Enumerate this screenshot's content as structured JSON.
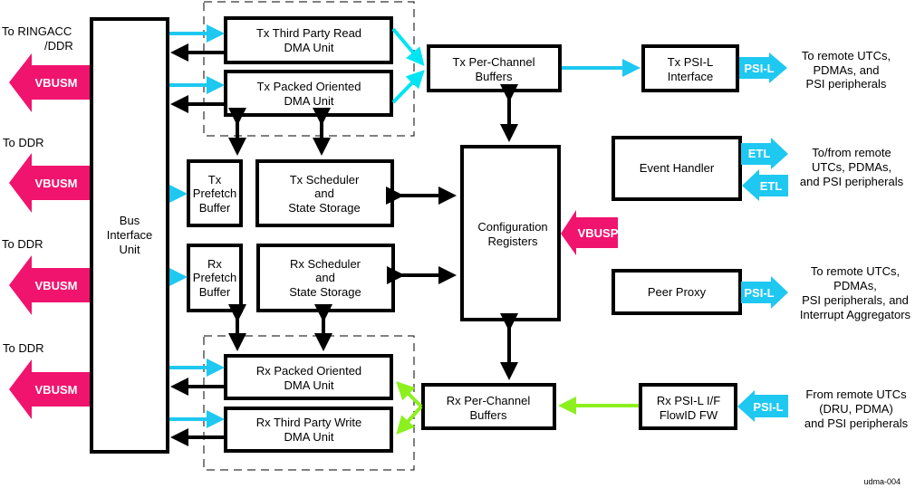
{
  "figure_id": "udma-004",
  "colors": {
    "vbusm": "#f0146e",
    "psil": "#1ec8f0",
    "tx_path": "#00e4f4",
    "rx_path": "#8cf01e",
    "line": "#000000"
  },
  "left_labels": {
    "l1": [
      "To RINGACC",
      "/DDR"
    ],
    "l2": "To DDR",
    "l3": "To DDR",
    "l4": "To DDR"
  },
  "buses": {
    "vbusm": "VBUSM",
    "vbusp": "VBUSP",
    "psil": "PSI-L",
    "etl": "ETL"
  },
  "blocks": {
    "bus_interface": [
      "Bus",
      "Interface",
      "Unit"
    ],
    "tx_third_party": [
      "Tx Third Party Read",
      "DMA Unit"
    ],
    "tx_packed": [
      "Tx Packed Oriented",
      "DMA Unit"
    ],
    "tx_prefetch": [
      "Tx",
      "Prefetch",
      "Buffer"
    ],
    "tx_scheduler": [
      "Tx Scheduler",
      "and",
      "State Storage"
    ],
    "rx_prefetch": [
      "Rx",
      "Prefetch",
      "Buffer"
    ],
    "rx_scheduler": [
      "Rx Scheduler",
      "and",
      "State Storage"
    ],
    "rx_packed": [
      "Rx Packed Oriented",
      "DMA Unit"
    ],
    "rx_third_party": [
      "Rx Third Party Write",
      "DMA Unit"
    ],
    "tx_per_channel": [
      "Tx Per-Channel",
      "Buffers"
    ],
    "config_registers": [
      "Configuration",
      "Registers"
    ],
    "rx_per_channel": [
      "Rx Per-Channel",
      "Buffers"
    ],
    "tx_psil_interface": [
      "Tx PSI-L",
      "Interface"
    ],
    "event_handler": "Event Handler",
    "peer_proxy": "Peer Proxy",
    "rx_psil_if": [
      "Rx PSI-L I/F",
      "FlowID FW"
    ]
  },
  "right_labels": {
    "tx_psil": [
      "To remote UTCs,",
      "PDMAs, and",
      "PSI peripherals"
    ],
    "etl": [
      "To/from remote",
      "UTCs, PDMAs,",
      "and PSI peripherals"
    ],
    "peer_proxy": [
      "To remote UTCs,",
      "PDMAs,",
      "PSI peripherals, and",
      "Interrupt Aggregators"
    ],
    "rx_psil": [
      "From remote UTCs",
      "(DRU, PDMA)",
      "and PSI peripherals"
    ]
  }
}
